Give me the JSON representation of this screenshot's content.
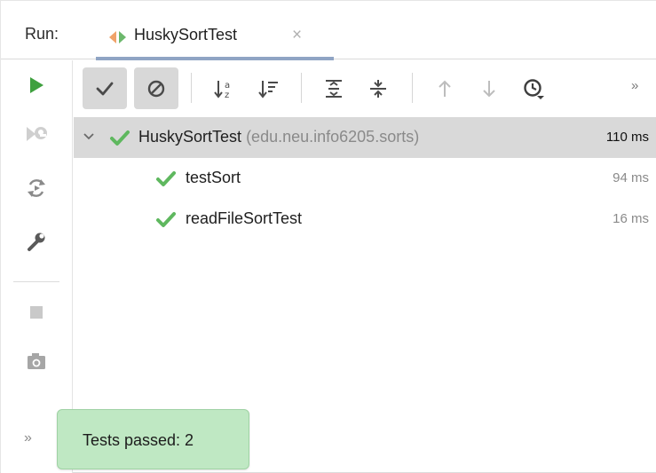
{
  "header": {
    "run_label": "Run:",
    "tab_title": "HuskySortTest",
    "tab_close": "×"
  },
  "left_toolbar": {
    "items": [
      {
        "name": "rerun",
        "icon": "play-icon"
      },
      {
        "name": "rerun-failed",
        "icon": "rerun-failed-icon"
      },
      {
        "name": "toggle-auto-test",
        "icon": "auto-rerun-icon"
      },
      {
        "name": "settings",
        "icon": "wrench-icon"
      },
      {
        "name": "stop",
        "icon": "stop-icon"
      },
      {
        "name": "screenshot",
        "icon": "camera-icon"
      }
    ],
    "more": "»"
  },
  "tree_toolbar": {
    "items": [
      {
        "name": "show-passed",
        "icon": "check-icon",
        "pressed": true
      },
      {
        "name": "show-ignored",
        "icon": "ignored-icon",
        "pressed": true
      },
      {
        "name": "sort-alphabetically",
        "icon": "sort-alpha-icon"
      },
      {
        "name": "sort-by-duration",
        "icon": "sort-duration-icon"
      },
      {
        "name": "expand-all",
        "icon": "expand-all-icon"
      },
      {
        "name": "collapse-all",
        "icon": "collapse-all-icon"
      },
      {
        "name": "previous-failed",
        "icon": "arrow-up-icon"
      },
      {
        "name": "next-failed",
        "icon": "arrow-down-icon"
      },
      {
        "name": "test-history",
        "icon": "clock-icon"
      }
    ],
    "more": "»"
  },
  "tree": {
    "root": {
      "name": "HuskySortTest",
      "package": "(edu.neu.info6205.sorts)",
      "time": "110 ms",
      "status": "passed"
    },
    "children": [
      {
        "name": "testSort",
        "time": "94 ms",
        "status": "passed"
      },
      {
        "name": "readFileSortTest",
        "time": "16 ms",
        "status": "passed"
      }
    ]
  },
  "toast": {
    "text": "Tests passed: 2"
  },
  "colors": {
    "pass_green": "#5fb85f",
    "run_green": "#3ea03e",
    "selected_row": "#d9d9d9",
    "toast_bg": "#bfe8c3",
    "tab_underline": "#8fa4c4"
  }
}
